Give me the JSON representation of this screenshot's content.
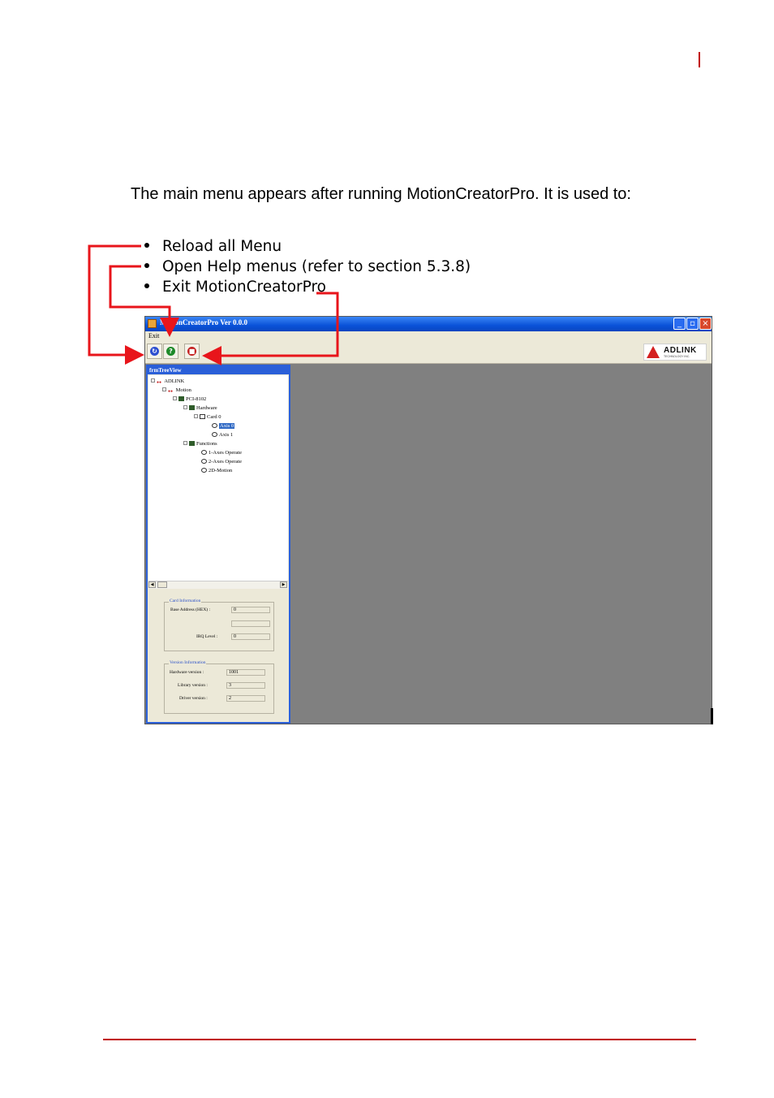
{
  "doc": {
    "intro": "The main menu appears after running MotionCreatorPro. It is used to:",
    "bullets": [
      "Reload all Menu",
      "Open Help menus (refer to section 5.3.8)",
      "Exit MotionCreatorPro"
    ],
    "colors": {
      "accent": "#c00000",
      "arrow": "#e8151b"
    }
  },
  "app": {
    "title": "MotionCreatorPro Ver 0.0.0",
    "window_buttons": {
      "minimize": "_",
      "maximize": "▫",
      "close": "×"
    },
    "menu": {
      "exit": "Exit"
    },
    "toolbar": {
      "reload_icon": "reload-icon",
      "help_icon": "help-icon",
      "exit_icon": "stop-icon"
    },
    "logo": {
      "text": "ADLINK",
      "sub": "TECHNOLOGY INC."
    },
    "tree_window": {
      "title": "frmTreeView",
      "nodes": [
        {
          "label": "ADLINK",
          "icon": "root-icon"
        },
        {
          "label": "Motion",
          "icon": "root-icon"
        },
        {
          "label": "PCI-8102",
          "icon": "folder-icon"
        },
        {
          "label": "Hardware",
          "icon": "folder-icon"
        },
        {
          "label": "Card 0",
          "icon": "card-icon"
        },
        {
          "label": "Axis 0",
          "icon": "axis-icon",
          "selected": true
        },
        {
          "label": "Axis 1",
          "icon": "axis-icon"
        },
        {
          "label": "Functions",
          "icon": "folder-icon"
        },
        {
          "label": "1-Axes Operate",
          "icon": "axis-icon"
        },
        {
          "label": "2-Axes Operate",
          "icon": "axis-icon"
        },
        {
          "label": "2D-Motion",
          "icon": "axis-icon"
        }
      ],
      "card_info": {
        "title": "Card Information",
        "base_label": "Base Address (HEX) :",
        "base_value": "0",
        "irq_label": "IRQ Level :",
        "irq_value": "0"
      },
      "version_info": {
        "title": "Version Information",
        "hardware_label": "Hardware version :",
        "hardware_value": "1001",
        "library_label": "Library version :",
        "library_value": "3",
        "driver_label": "Driver version :",
        "driver_value": "2"
      }
    }
  }
}
